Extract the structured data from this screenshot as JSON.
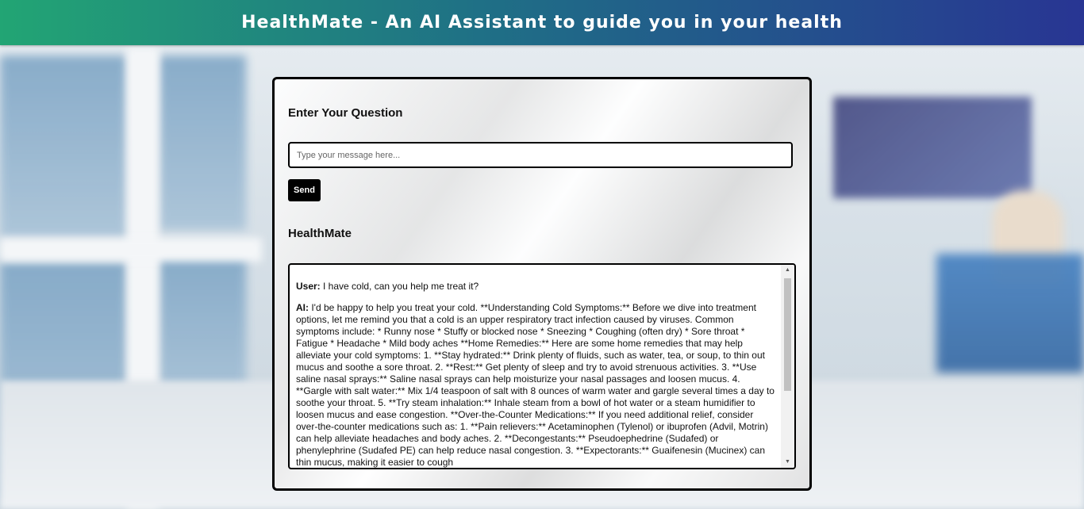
{
  "header": {
    "title": "HealthMate - An AI Assistant to guide you in your health"
  },
  "question": {
    "label": "Enter Your Question",
    "input_placeholder": "Type your message here...",
    "input_value": "",
    "send_label": "Send"
  },
  "response": {
    "label": "HealthMate",
    "messages": [
      {
        "speaker": "User:",
        "text": "I have cold, can you help me treat it?"
      },
      {
        "speaker": "AI:",
        "text": "I'd be happy to help you treat your cold. **Understanding Cold Symptoms:** Before we dive into treatment options, let me remind you that a cold is an upper respiratory tract infection caused by viruses. Common symptoms include: * Runny nose * Stuffy or blocked nose * Sneezing * Coughing (often dry) * Sore throat * Fatigue * Headache * Mild body aches **Home Remedies:** Here are some home remedies that may help alleviate your cold symptoms: 1. **Stay hydrated:** Drink plenty of fluids, such as water, tea, or soup, to thin out mucus and soothe a sore throat. 2. **Rest:** Get plenty of sleep and try to avoid strenuous activities. 3. **Use saline nasal sprays:** Saline nasal sprays can help moisturize your nasal passages and loosen mucus. 4. **Gargle with salt water:** Mix 1/4 teaspoon of salt with 8 ounces of warm water and gargle several times a day to soothe your throat. 5. **Try steam inhalation:** Inhale steam from a bowl of hot water or a steam humidifier to loosen mucus and ease congestion. **Over-the-Counter Medications:** If you need additional relief, consider over-the-counter medications such as: 1. **Pain relievers:** Acetaminophen (Tylenol) or ibuprofen (Advil, Motrin) can help alleviate headaches and body aches. 2. **Decongestants:** Pseudoephedrine (Sudafed) or phenylephrine (Sudafed PE) can help reduce nasal congestion. 3. **Expectorants:** Guaifenesin (Mucinex) can thin mucus, making it easier to cough"
      }
    ]
  },
  "icons": {
    "scroll_up": "scroll-up-arrow-icon",
    "scroll_down": "scroll-down-arrow-icon"
  },
  "colors": {
    "header_gradient_start": "#22a574",
    "header_gradient_end": "#283593",
    "button_bg": "#000000"
  }
}
